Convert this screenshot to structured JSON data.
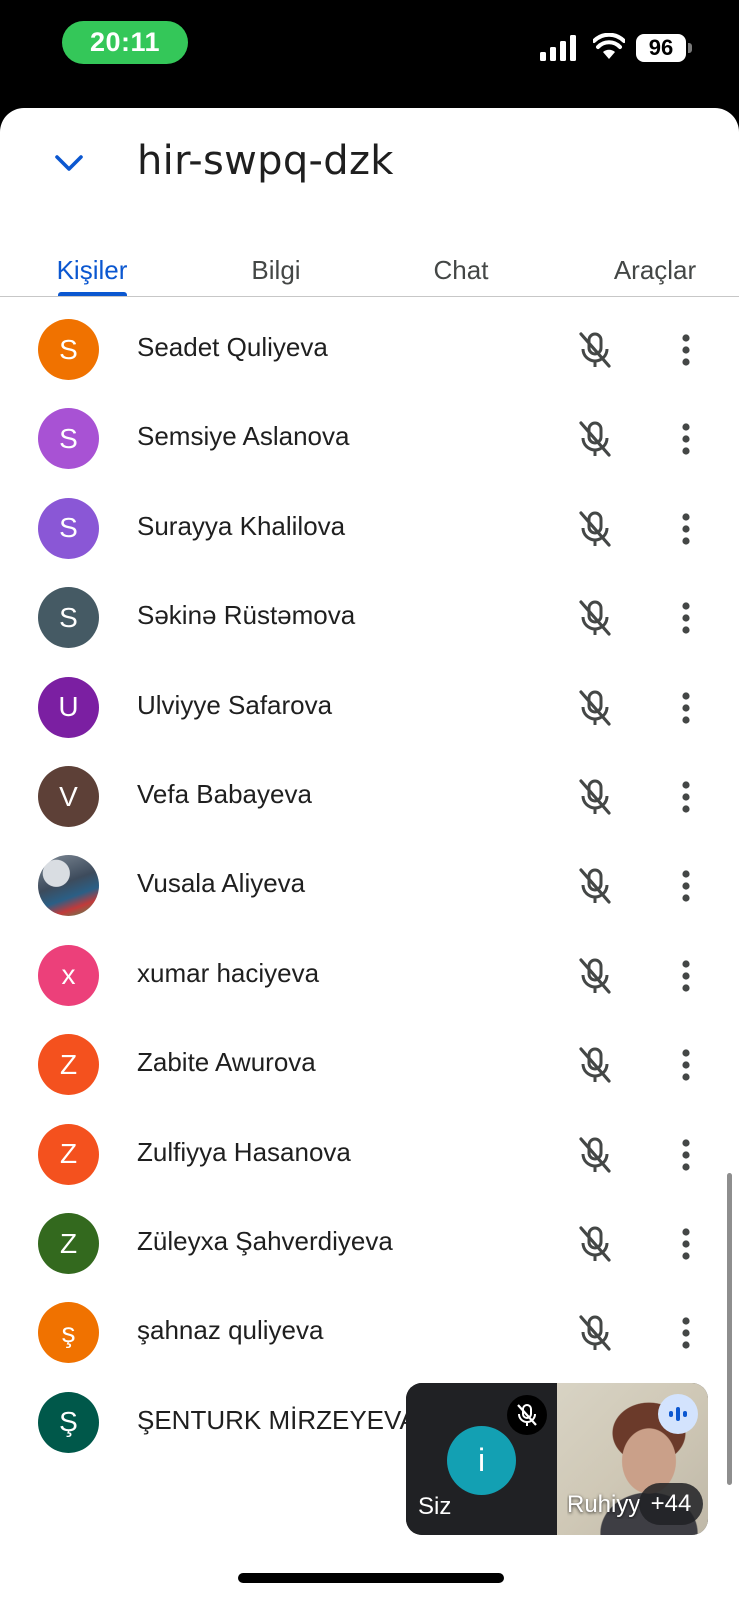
{
  "status_bar": {
    "time": "20:11",
    "battery": "96",
    "time_pill_color": "#34c759",
    "icons": [
      "signal-icon",
      "wifi-icon",
      "battery-icon"
    ]
  },
  "header": {
    "meeting_code": "hir-swpq-dzk",
    "collapse_icon": "chevron-down-icon"
  },
  "tabs": [
    {
      "label": "Kişiler",
      "active": true
    },
    {
      "label": "Bilgi",
      "active": false
    },
    {
      "label": "Chat",
      "active": false
    },
    {
      "label": "Araçlar",
      "active": false
    }
  ],
  "accent_color": "#0b57d0",
  "participants": [
    {
      "initial": "S",
      "name": "Seadet Quliyeva",
      "color": "#f07200",
      "muted": true
    },
    {
      "initial": "S",
      "name": "Semsiye Aslanova",
      "color": "#a852d4",
      "muted": true
    },
    {
      "initial": "S",
      "name": "Surayya Khalilova",
      "color": "#8a57d6",
      "muted": true
    },
    {
      "initial": "S",
      "name": "Səkinə Rüstəmova",
      "color": "#455a64",
      "muted": true
    },
    {
      "initial": "U",
      "name": "Ulviyye Safarova",
      "color": "#7b1fa2",
      "muted": true
    },
    {
      "initial": "V",
      "name": "Vefa Babayeva",
      "color": "#5d4037",
      "muted": true
    },
    {
      "initial": "",
      "name": "Vusala Aliyeva",
      "color": "#5a6b7c",
      "muted": true,
      "photo": true
    },
    {
      "initial": "x",
      "name": "xumar haciyeva",
      "color": "#ec407a",
      "muted": true
    },
    {
      "initial": "Z",
      "name": "Zabite Awurova",
      "color": "#f4511e",
      "muted": true
    },
    {
      "initial": "Z",
      "name": "Zulfiyya Hasanova",
      "color": "#f4511e",
      "muted": true
    },
    {
      "initial": "Z",
      "name": "Züleyxa Şahverdiyeva",
      "color": "#33691e",
      "muted": true
    },
    {
      "initial": "ş",
      "name": "şahnaz quliyeva",
      "color": "#f07200",
      "muted": true
    },
    {
      "initial": "Ş",
      "name": "ŞENTURK MİRZEYEVA",
      "color": "#00584a",
      "muted": false
    }
  ],
  "pip": {
    "self_initial": "i",
    "self_label": "Siz",
    "self_avatar_color": "#13a0b3",
    "remote_label": "Ruhiyy",
    "more_count": "+44"
  }
}
